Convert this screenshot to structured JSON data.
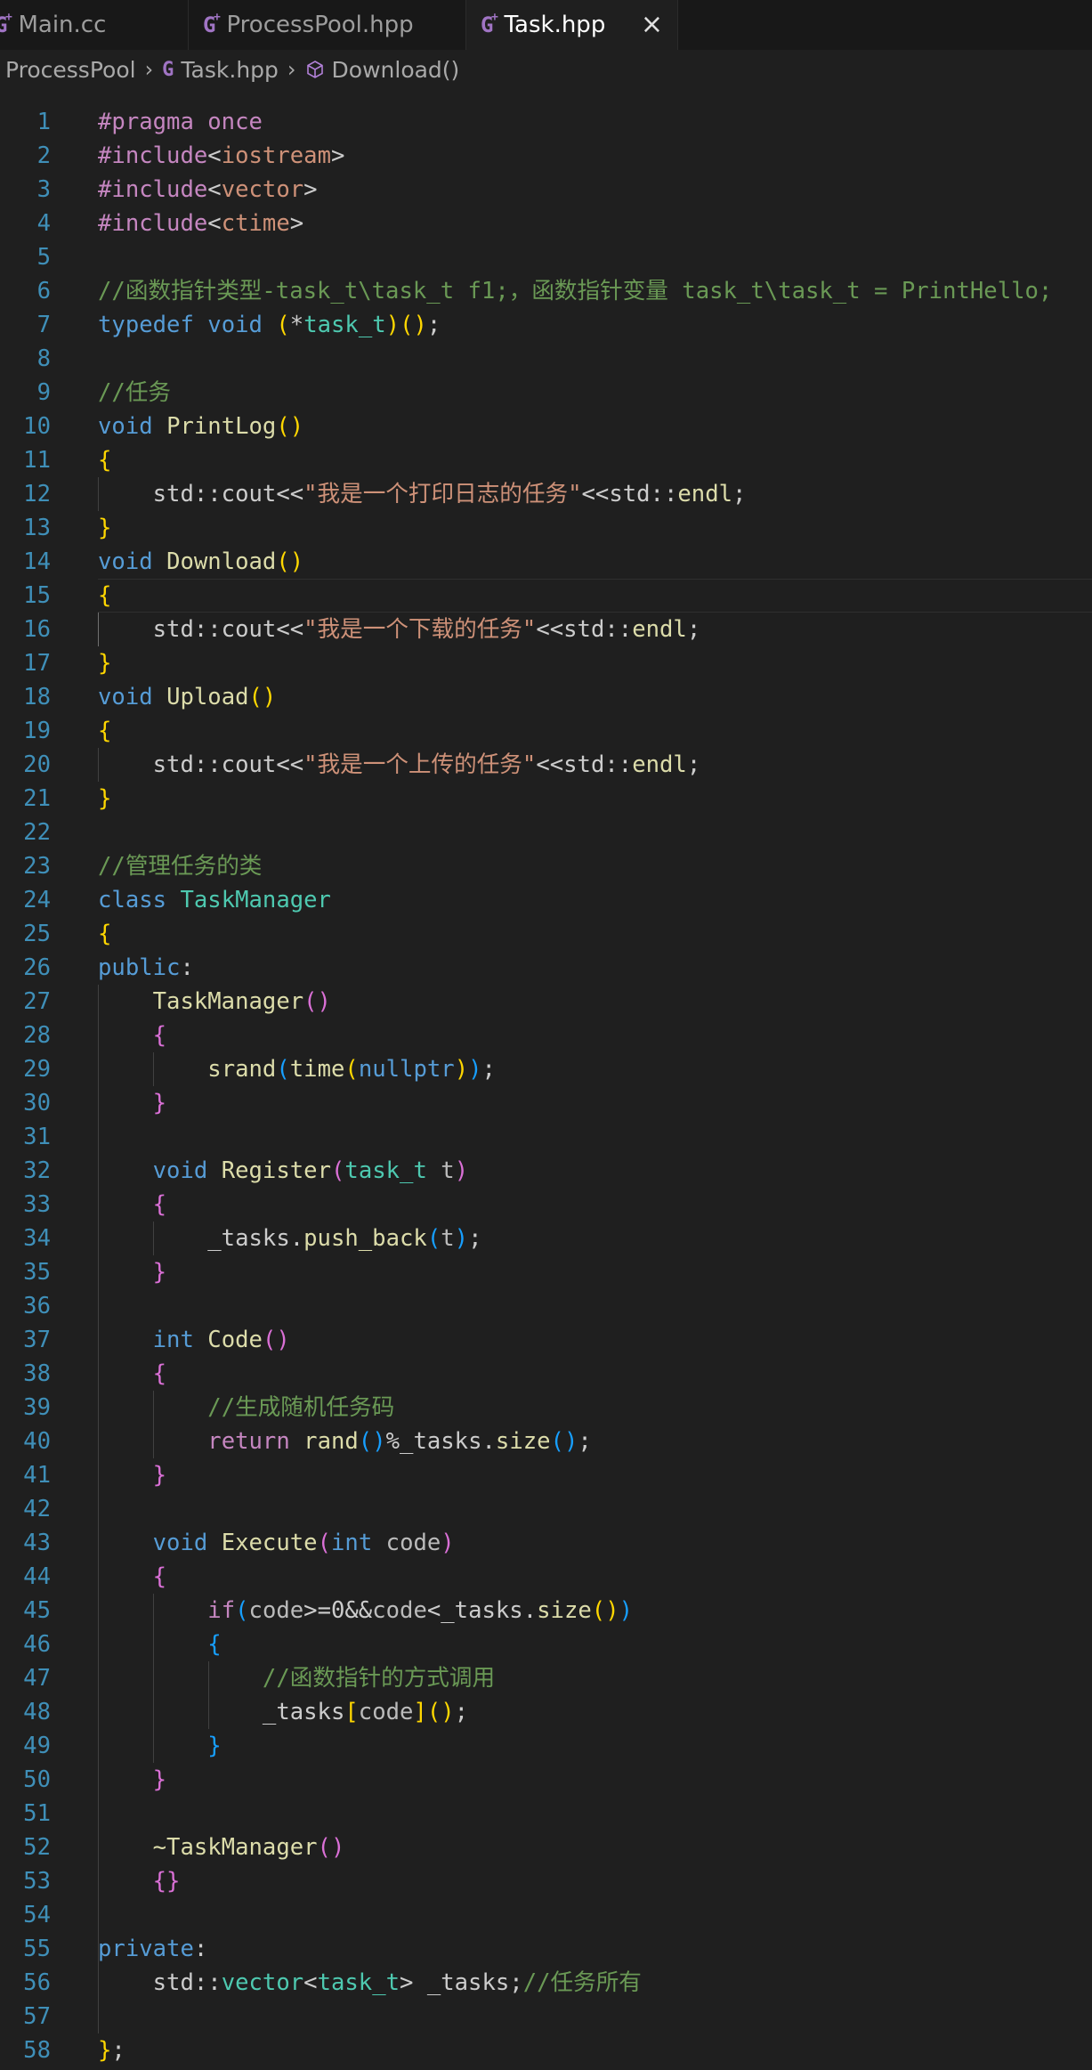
{
  "tabs": [
    {
      "label": "Main.cc",
      "active": false
    },
    {
      "label": "ProcessPool.hpp",
      "active": false
    },
    {
      "label": "Task.hpp",
      "active": true
    }
  ],
  "tab_icon_glyph": "G",
  "breadcrumb": [
    "ProcessPool",
    "Task.hpp",
    "Download()"
  ],
  "cursor_line": 15,
  "colors": {
    "keyword": "#569cd6",
    "function": "#dcdcaa",
    "type": "#4ec9b0",
    "string": "#ce9178",
    "comment": "#6a9955",
    "preprocessor": "#c586c0",
    "bracket1": "#ffd700",
    "bracket2": "#da70d6",
    "bracket3": "#179fff",
    "line_number": "#3f8fb8"
  },
  "lines": [
    [
      [
        "pp",
        "#pragma once"
      ]
    ],
    [
      [
        "pp",
        "#include"
      ],
      [
        "plain",
        "<"
      ],
      [
        "str",
        "iostream"
      ],
      [
        "plain",
        ">"
      ]
    ],
    [
      [
        "pp",
        "#include"
      ],
      [
        "plain",
        "<"
      ],
      [
        "str",
        "vector"
      ],
      [
        "plain",
        ">"
      ]
    ],
    [
      [
        "pp",
        "#include"
      ],
      [
        "plain",
        "<"
      ],
      [
        "str",
        "ctime"
      ],
      [
        "plain",
        ">"
      ]
    ],
    [],
    [
      [
        "cmt",
        "//函数指针类型-task_t\\task_t f1;，函数指针变量 task_t\\task_t = PrintHello;"
      ]
    ],
    [
      [
        "kw",
        "typedef"
      ],
      [
        "plain",
        " "
      ],
      [
        "kw",
        "void"
      ],
      [
        "plain",
        " "
      ],
      [
        "p1",
        "("
      ],
      [
        "plain",
        "*"
      ],
      [
        "type",
        "task_t"
      ],
      [
        "p1",
        ")"
      ],
      [
        "p1",
        "()"
      ],
      [
        "plain",
        ";"
      ]
    ],
    [],
    [
      [
        "cmt",
        "//任务"
      ]
    ],
    [
      [
        "kw",
        "void"
      ],
      [
        "plain",
        " "
      ],
      [
        "fn",
        "PrintLog"
      ],
      [
        "p1",
        "()"
      ]
    ],
    [
      [
        "p1",
        "{"
      ]
    ],
    [
      [
        "plain",
        "    std::cout<<"
      ],
      [
        "str",
        "\"我是一个打印日志的任务\""
      ],
      [
        "plain",
        "<<std::"
      ],
      [
        "fn",
        "endl"
      ],
      [
        "plain",
        ";"
      ]
    ],
    [
      [
        "p1",
        "}"
      ]
    ],
    [
      [
        "kw",
        "void"
      ],
      [
        "plain",
        " "
      ],
      [
        "fn",
        "Download"
      ],
      [
        "p1",
        "()"
      ]
    ],
    [
      [
        "p1",
        "{"
      ]
    ],
    [
      [
        "plain",
        "    std::cout<<"
      ],
      [
        "str",
        "\"我是一个下载的任务\""
      ],
      [
        "plain",
        "<<std::"
      ],
      [
        "fn",
        "endl"
      ],
      [
        "plain",
        ";"
      ]
    ],
    [
      [
        "p1",
        "}"
      ]
    ],
    [
      [
        "kw",
        "void"
      ],
      [
        "plain",
        " "
      ],
      [
        "fn",
        "Upload"
      ],
      [
        "p1",
        "()"
      ]
    ],
    [
      [
        "p1",
        "{"
      ]
    ],
    [
      [
        "plain",
        "    std::cout<<"
      ],
      [
        "str",
        "\"我是一个上传的任务\""
      ],
      [
        "plain",
        "<<std::"
      ],
      [
        "fn",
        "endl"
      ],
      [
        "plain",
        ";"
      ]
    ],
    [
      [
        "p1",
        "}"
      ]
    ],
    [],
    [
      [
        "cmt",
        "//管理任务的类"
      ]
    ],
    [
      [
        "kw",
        "class"
      ],
      [
        "plain",
        " "
      ],
      [
        "type",
        "TaskManager"
      ]
    ],
    [
      [
        "p1",
        "{"
      ]
    ],
    [
      [
        "kw",
        "public"
      ],
      [
        "plain",
        ":"
      ]
    ],
    [
      [
        "plain",
        "    "
      ],
      [
        "fn",
        "TaskManager"
      ],
      [
        "p2",
        "()"
      ]
    ],
    [
      [
        "plain",
        "    "
      ],
      [
        "p2",
        "{"
      ]
    ],
    [
      [
        "plain",
        "        "
      ],
      [
        "fn",
        "srand"
      ],
      [
        "p3",
        "("
      ],
      [
        "fn",
        "time"
      ],
      [
        "p1",
        "("
      ],
      [
        "kw",
        "nullptr"
      ],
      [
        "p1",
        ")"
      ],
      [
        "p3",
        ")"
      ],
      [
        "plain",
        ";"
      ]
    ],
    [
      [
        "plain",
        "    "
      ],
      [
        "p2",
        "}"
      ]
    ],
    [],
    [
      [
        "plain",
        "    "
      ],
      [
        "kw",
        "void"
      ],
      [
        "plain",
        " "
      ],
      [
        "fn",
        "Register"
      ],
      [
        "p2",
        "("
      ],
      [
        "type",
        "task_t"
      ],
      [
        "plain",
        " "
      ],
      [
        "gray",
        "t"
      ],
      [
        "p2",
        ")"
      ]
    ],
    [
      [
        "plain",
        "    "
      ],
      [
        "p2",
        "{"
      ]
    ],
    [
      [
        "plain",
        "        _tasks."
      ],
      [
        "fn",
        "push_back"
      ],
      [
        "p3",
        "("
      ],
      [
        "gray",
        "t"
      ],
      [
        "p3",
        ")"
      ],
      [
        "plain",
        ";"
      ]
    ],
    [
      [
        "plain",
        "    "
      ],
      [
        "p2",
        "}"
      ]
    ],
    [],
    [
      [
        "plain",
        "    "
      ],
      [
        "kw",
        "int"
      ],
      [
        "plain",
        " "
      ],
      [
        "fn",
        "Code"
      ],
      [
        "p2",
        "()"
      ]
    ],
    [
      [
        "plain",
        "    "
      ],
      [
        "p2",
        "{"
      ]
    ],
    [
      [
        "plain",
        "        "
      ],
      [
        "cmt",
        "//生成随机任务码"
      ]
    ],
    [
      [
        "plain",
        "        "
      ],
      [
        "ctl",
        "return"
      ],
      [
        "plain",
        " "
      ],
      [
        "fn",
        "rand"
      ],
      [
        "p3",
        "()"
      ],
      [
        "plain",
        "%_tasks."
      ],
      [
        "fn",
        "size"
      ],
      [
        "p3",
        "()"
      ],
      [
        "plain",
        ";"
      ]
    ],
    [
      [
        "plain",
        "    "
      ],
      [
        "p2",
        "}"
      ]
    ],
    [],
    [
      [
        "plain",
        "    "
      ],
      [
        "kw",
        "void"
      ],
      [
        "plain",
        " "
      ],
      [
        "fn",
        "Execute"
      ],
      [
        "p2",
        "("
      ],
      [
        "kw",
        "int"
      ],
      [
        "plain",
        " "
      ],
      [
        "gray",
        "code"
      ],
      [
        "p2",
        ")"
      ]
    ],
    [
      [
        "plain",
        "    "
      ],
      [
        "p2",
        "{"
      ]
    ],
    [
      [
        "plain",
        "        "
      ],
      [
        "ctl",
        "if"
      ],
      [
        "p3",
        "("
      ],
      [
        "gray",
        "code"
      ],
      [
        "plain",
        ">=0&&"
      ],
      [
        "gray",
        "code"
      ],
      [
        "plain",
        "<_tasks."
      ],
      [
        "fn",
        "size"
      ],
      [
        "p1",
        "()"
      ],
      [
        "p3",
        ")"
      ]
    ],
    [
      [
        "plain",
        "        "
      ],
      [
        "p3",
        "{"
      ]
    ],
    [
      [
        "plain",
        "            "
      ],
      [
        "cmt",
        "//函数指针的方式调用"
      ]
    ],
    [
      [
        "plain",
        "            _tasks"
      ],
      [
        "p1",
        "["
      ],
      [
        "gray",
        "code"
      ],
      [
        "p1",
        "]"
      ],
      [
        "p1",
        "()"
      ],
      [
        "plain",
        ";"
      ]
    ],
    [
      [
        "plain",
        "        "
      ],
      [
        "p3",
        "}"
      ]
    ],
    [
      [
        "plain",
        "    "
      ],
      [
        "p2",
        "}"
      ]
    ],
    [],
    [
      [
        "plain",
        "    "
      ],
      [
        "fn",
        "~TaskManager"
      ],
      [
        "p2",
        "()"
      ]
    ],
    [
      [
        "plain",
        "    "
      ],
      [
        "p2",
        "{}"
      ]
    ],
    [],
    [
      [
        "kw",
        "private"
      ],
      [
        "plain",
        ":"
      ]
    ],
    [
      [
        "plain",
        "    std::"
      ],
      [
        "type",
        "vector"
      ],
      [
        "plain",
        "<"
      ],
      [
        "type",
        "task_t"
      ],
      [
        "plain",
        "> _tasks;"
      ],
      [
        "cmt",
        "//任务所有"
      ]
    ],
    [],
    [
      [
        "p1",
        "}"
      ],
      [
        "plain",
        ";"
      ]
    ]
  ]
}
